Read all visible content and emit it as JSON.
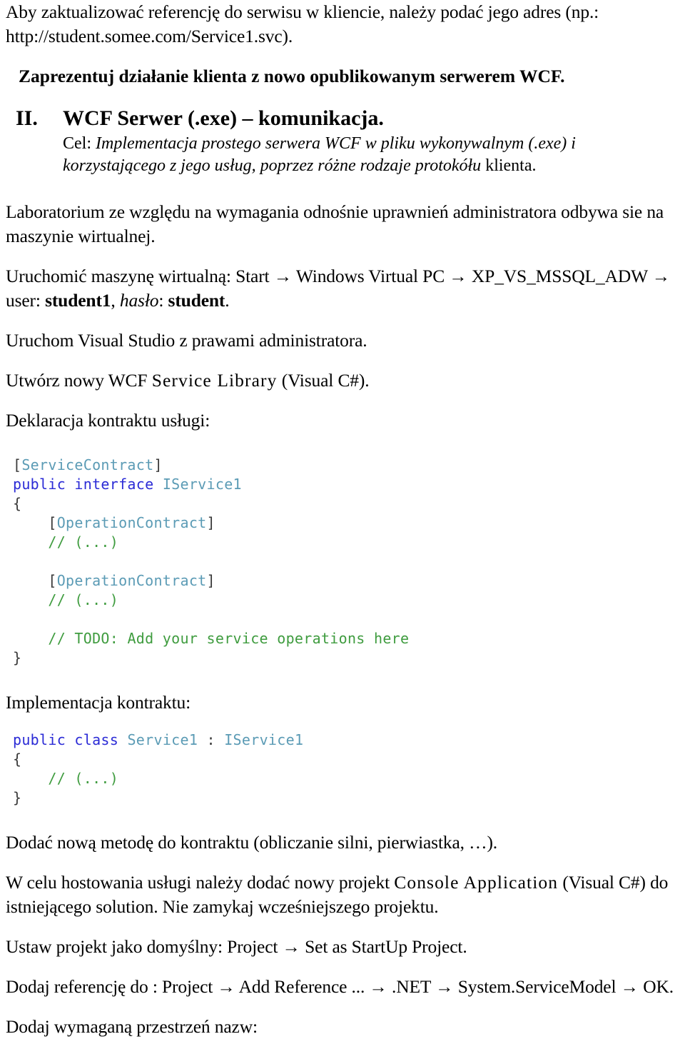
{
  "document": {
    "language": "pl",
    "colors": {
      "background": "#ffffff",
      "text": "#000000",
      "code_keyword": "#2b2bd6",
      "code_type": "#5b9bb5",
      "code_comment": "#3f9c3f",
      "code_punctuation": "#3a3a3a"
    }
  },
  "intro": {
    "line1": "Aby zaktualizować referencję do serwisu w kliencie, należy podać jego adres (np.:",
    "line2": "http://student.somee.com/Service1.svc)."
  },
  "bold_heading": "Zaprezentuj działanie klienta z nowo opublikowanym serwerem WCF.",
  "section": {
    "number": "II.",
    "title": "WCF Serwer (.exe) – komunikacja.",
    "goal_label": "Cel:",
    "goal_text": "Implementacja prostego serwera WCF w pliku wykonywalnym (.exe) i korzystającego z jego usług, poprzez różne rodzaje protokółu",
    "goal_tail": "klienta."
  },
  "steps": {
    "lab_note": "Laboratorium ze względu na wymagania odnośnie uprawnień administratora odbywa sie na maszynie wirtualnej.",
    "vm_start": {
      "prefix": "Uruchomić maszynę wirtualną: Start",
      "item1": "Windows Virtual PC",
      "item2": "XP_VS_MSSQL_ADW",
      "user_label": "user:",
      "user_value": "student1",
      "password_label": "hasło",
      "password_value": "student",
      "arrow": "→"
    },
    "run_vs": "Uruchom Visual Studio z prawami administratora.",
    "create_lib_prefix": "Utwórz nowy WCF",
    "create_lib_tracked": "Service Library",
    "create_lib_suffix": "(Visual C#).",
    "contract_declaration_label": "Deklaracja kontraktu usługi:",
    "contract_implementation_label": "Implementacja kontraktu:",
    "add_method": "Dodać nową metodę do kontraktu (obliczanie silni, pierwiastka, …).",
    "host_prefix": "W celu hostowania usługi należy dodać nowy projekt",
    "host_tracked": "Console Application",
    "host_suffix": "(Visual C#) do istniejącego solution. Nie zamykaj wcześniejszego projektu.",
    "startup_project": {
      "prefix": "Ustaw projekt jako domyślny: Project",
      "item1": "Set as StartUp Project.",
      "arrow": "→"
    },
    "add_reference": {
      "prefix": "Dodaj referencję do : Project",
      "item1": "Add Reference ...",
      "item2": ".NET",
      "item3": "System.ServiceModel",
      "item4": "OK.",
      "arrow": "→"
    },
    "add_namespace": "Dodaj wymaganą przestrzeń nazw:"
  },
  "code_contract": {
    "lines": [
      {
        "indent": 0,
        "tokens": [
          {
            "t": "[",
            "c": "punct"
          },
          {
            "t": "ServiceContract",
            "c": "type"
          },
          {
            "t": "]",
            "c": "punct"
          }
        ]
      },
      {
        "indent": 0,
        "tokens": [
          {
            "t": "public",
            "c": "kw"
          },
          {
            "t": " ",
            "c": "plain"
          },
          {
            "t": "interface",
            "c": "kw"
          },
          {
            "t": " ",
            "c": "plain"
          },
          {
            "t": "IService1",
            "c": "type"
          }
        ]
      },
      {
        "indent": 0,
        "tokens": [
          {
            "t": "{",
            "c": "punct"
          }
        ]
      },
      {
        "indent": 1,
        "tokens": [
          {
            "t": "[",
            "c": "punct"
          },
          {
            "t": "OperationContract",
            "c": "type"
          },
          {
            "t": "]",
            "c": "punct"
          }
        ]
      },
      {
        "indent": 1,
        "tokens": [
          {
            "t": "// (...)",
            "c": "cmt"
          }
        ]
      },
      {
        "indent": 0,
        "tokens": []
      },
      {
        "indent": 1,
        "tokens": [
          {
            "t": "[",
            "c": "punct"
          },
          {
            "t": "OperationContract",
            "c": "type"
          },
          {
            "t": "]",
            "c": "punct"
          }
        ]
      },
      {
        "indent": 1,
        "tokens": [
          {
            "t": "// (...)",
            "c": "cmt"
          }
        ]
      },
      {
        "indent": 0,
        "tokens": []
      },
      {
        "indent": 1,
        "tokens": [
          {
            "t": "// TODO: Add your service operations here",
            "c": "cmt"
          }
        ]
      },
      {
        "indent": 0,
        "tokens": [
          {
            "t": "}",
            "c": "punct"
          }
        ]
      }
    ]
  },
  "code_implementation": {
    "lines": [
      {
        "indent": 0,
        "tokens": [
          {
            "t": "public",
            "c": "kw"
          },
          {
            "t": " ",
            "c": "plain"
          },
          {
            "t": "class",
            "c": "kw"
          },
          {
            "t": " ",
            "c": "plain"
          },
          {
            "t": "Service1",
            "c": "type"
          },
          {
            "t": " : ",
            "c": "punct"
          },
          {
            "t": "IService1",
            "c": "type"
          }
        ]
      },
      {
        "indent": 0,
        "tokens": [
          {
            "t": "{",
            "c": "punct"
          }
        ]
      },
      {
        "indent": 1,
        "tokens": [
          {
            "t": "// (...)",
            "c": "cmt"
          }
        ]
      },
      {
        "indent": 0,
        "tokens": [
          {
            "t": "}",
            "c": "punct"
          }
        ]
      }
    ]
  }
}
